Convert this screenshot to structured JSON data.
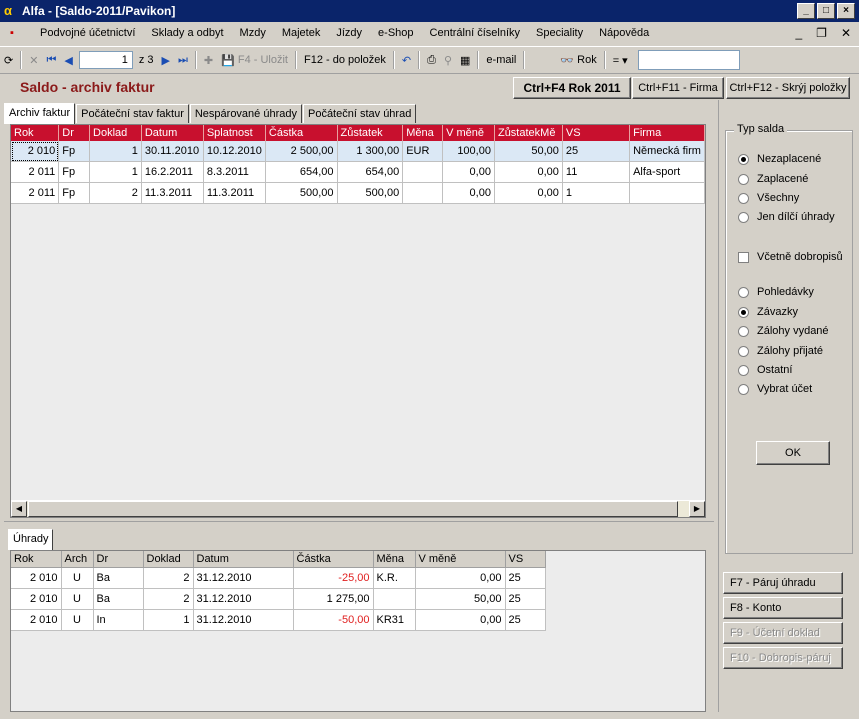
{
  "window": {
    "title": "Alfa - [Saldo-2011/Pavikon]",
    "logo": "α"
  },
  "menu": [
    "Podvojné účetnictví",
    "Sklady a odbyt",
    "Mzdy",
    "Majetek",
    "Jízdy",
    "e-Shop",
    "Centrální číselníky",
    "Speciality",
    "Nápověda"
  ],
  "toolbar": {
    "page_value": "1",
    "page_total": "z 3",
    "save_label": "F4 - Uložit",
    "items_label": "F12 - do položek",
    "email_label": "e-mail",
    "year_label": "Rok",
    "eq_label": "= ▾"
  },
  "header": {
    "title": "Saldo - archiv faktur",
    "btn_year": "Ctrl+F4 Rok 2011",
    "btn_company": "Ctrl+F11 - Firma",
    "btn_hide": "Ctrl+F12 - Skrýj položky"
  },
  "tabs": [
    "Archiv faktur",
    "Počáteční stav faktur",
    "Nespárované úhrady",
    "Počáteční stav úhrad"
  ],
  "grid": {
    "columns": [
      "Rok",
      "Dr",
      "Doklad",
      "Datum",
      "Splatnost",
      "Částka",
      "Zůstatek",
      "Měna",
      "V měně",
      "ZůstatekMě",
      "VS",
      "Firma"
    ],
    "rows": [
      [
        "2 010",
        "Fp",
        "1",
        "30.11.2010",
        "10.12.2010",
        "2 500,00",
        "1 300,00",
        "EUR",
        "100,00",
        "50,00",
        "25",
        "Německá firm"
      ],
      [
        "2 011",
        "Fp",
        "1",
        "16.2.2011",
        "8.3.2011",
        "654,00",
        "654,00",
        "",
        "0,00",
        "0,00",
        "11",
        "Alfa-sport"
      ],
      [
        "2 011",
        "Fp",
        "2",
        "11.3.2011",
        "11.3.2011",
        "500,00",
        "500,00",
        "",
        "0,00",
        "0,00",
        "1",
        ""
      ]
    ]
  },
  "bottom_tab": "Úhrady",
  "bgrid": {
    "columns": [
      "Rok",
      "Arch",
      "Dr",
      "Doklad",
      "Datum",
      "Částka",
      "Měna",
      "V měně",
      "VS"
    ],
    "rows": [
      [
        "2 010",
        "U",
        "Ba",
        "2",
        "31.12.2010",
        "-25,00",
        "K.R.",
        "0,00",
        "25"
      ],
      [
        "2 010",
        "U",
        "Ba",
        "2",
        "31.12.2010",
        "1 275,00",
        "",
        "50,00",
        "25"
      ],
      [
        "2 010",
        "U",
        "In",
        "1",
        "31.12.2010",
        "-50,00",
        "KR31",
        "0,00",
        "25"
      ]
    ]
  },
  "side": {
    "group_title": "Typ salda",
    "saldo_options": [
      "Nezaplacené",
      "Zaplacené",
      "Všechny",
      "Jen dílčí úhrady"
    ],
    "credit_notes": "Včetně dobropisů",
    "account_options": [
      "Pohledávky",
      "Závazky",
      "Zálohy vydané",
      "Zálohy přijaté",
      "Ostatní",
      "Vybrat účet"
    ],
    "ok": "OK",
    "btn_pair": "F7 - Páruj úhradu",
    "btn_account": "F8 - Konto",
    "btn_doc": "F9 - Účetní doklad",
    "btn_credit": "F10 - Dobropis-páruj"
  }
}
